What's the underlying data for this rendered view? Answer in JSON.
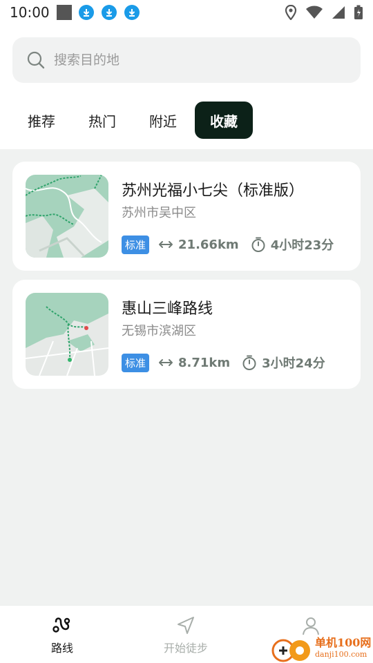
{
  "status_bar": {
    "time": "10:00",
    "icons": [
      "stop-square-icon",
      "download-icon",
      "download-icon",
      "download-icon",
      "location-icon",
      "wifi-icon",
      "signal-icon",
      "battery-icon"
    ]
  },
  "search": {
    "placeholder": "搜索目的地"
  },
  "tabs": [
    {
      "label": "推荐",
      "active": false
    },
    {
      "label": "热门",
      "active": false
    },
    {
      "label": "附近",
      "active": false
    },
    {
      "label": "收藏",
      "active": true
    }
  ],
  "routes": [
    {
      "title": "苏州光福小七尖（标准版）",
      "location": "苏州市吴中区",
      "badge": "标准",
      "distance": "21.66km",
      "duration": "4小时23分"
    },
    {
      "title": "惠山三峰路线",
      "location": "无锡市滨湖区",
      "badge": "标准",
      "distance": "8.71km",
      "duration": "3小时24分"
    }
  ],
  "bottom_nav": {
    "items": [
      {
        "label": "路线",
        "icon": "route-icon",
        "active": true
      },
      {
        "label": "开始徒步",
        "icon": "navigation-arrow-icon",
        "active": false
      },
      {
        "label": "",
        "icon": "profile-icon",
        "active": false
      }
    ]
  },
  "watermark": {
    "line1": "单机100网",
    "line2": "danji100.com"
  },
  "colors": {
    "tab_active_bg": "#0c2118",
    "badge": "#3d8fe4",
    "content_bg": "#f0f2f1",
    "download_icon": "#1a9be8",
    "map_green": "#9ccfb5"
  }
}
